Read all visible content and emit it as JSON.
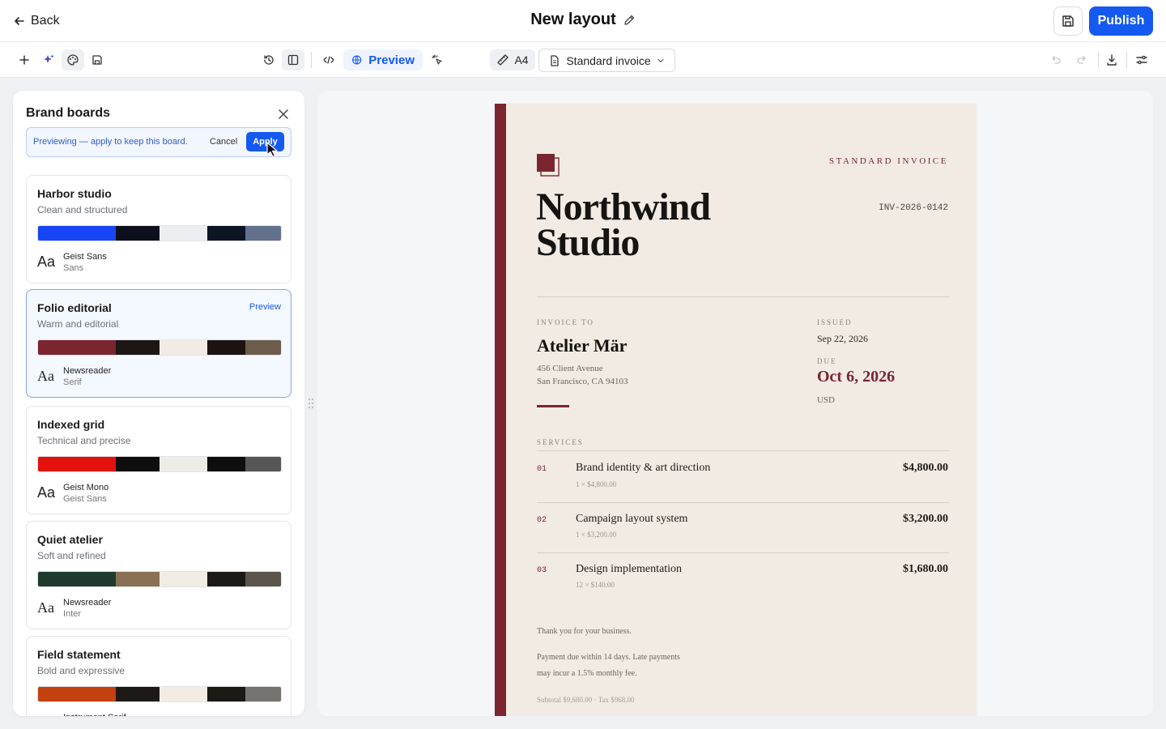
{
  "header": {
    "back_label": "Back",
    "title": "New layout",
    "publish_label": "Publish"
  },
  "toolbar": {
    "preview_label": "Preview",
    "paper_size": "A4",
    "template": "Standard invoice"
  },
  "panel": {
    "title": "Brand boards",
    "notice": {
      "text": "Previewing — apply to keep this board.",
      "cancel": "Cancel",
      "apply": "Apply"
    },
    "boards": [
      {
        "name": "Harbor studio",
        "desc": "Clean and structured",
        "colors": [
          "#1745f5",
          "#0c101c",
          "#eceef2",
          "#0d1424",
          "#62718c"
        ],
        "font": "Geist Sans",
        "font_sub": "Sans",
        "aa_serif": false
      },
      {
        "name": "Folio editorial",
        "desc": "Warm and editorial",
        "preview": "Preview",
        "colors": [
          "#7a2530",
          "#1c1714",
          "#f1ebe3",
          "#1c1310",
          "#6c5c4c"
        ],
        "font": "Newsreader",
        "font_sub": "Serif",
        "aa_serif": true
      },
      {
        "name": "Indexed grid",
        "desc": "Technical and precise",
        "colors": [
          "#e3120e",
          "#0e0e0e",
          "#eeece6",
          "#0e0e0e",
          "#565656"
        ],
        "font": "Geist Mono",
        "font_sub": "Geist Sans",
        "aa_serif": false
      },
      {
        "name": "Quiet atelier",
        "desc": "Soft and refined",
        "colors": [
          "#1f3a2c",
          "#8a7154",
          "#f1ece4",
          "#1c1916",
          "#5b554c"
        ],
        "font": "Newsreader",
        "font_sub": "Inter",
        "aa_serif": true
      },
      {
        "name": "Field statement",
        "desc": "Bold and expressive",
        "colors": [
          "#c3410f",
          "#1c1916",
          "#f2ece3",
          "#1c1814",
          "#757370"
        ],
        "font": "Instrument Serif",
        "font_sub": "",
        "aa_serif": true
      }
    ]
  },
  "invoice": {
    "label": "STANDARD INVOICE",
    "company_line1": "Northwind",
    "company_line2": "Studio",
    "number": "INV-2026-0142",
    "invoice_to_label": "INVOICE TO",
    "client": "Atelier Mär",
    "addr1": "456 Client Avenue",
    "addr2": "San Francisco, CA 94103",
    "issued_label": "ISSUED",
    "issued": "Sep 22, 2026",
    "due_label": "DUE",
    "due": "Oct 6, 2026",
    "currency": "USD",
    "services_label": "SERVICES",
    "items": [
      {
        "num": "01",
        "name": "Brand identity & art direction",
        "sub": "1 × $4,800.00",
        "amount": "$4,800.00"
      },
      {
        "num": "02",
        "name": "Campaign layout system",
        "sub": "1 × $3,200.00",
        "amount": "$3,200.00"
      },
      {
        "num": "03",
        "name": "Design implementation",
        "sub": "12 × $140.00",
        "amount": "$1,680.00"
      }
    ],
    "thanks": "Thank you for your business.",
    "terms1": "Payment due within 14 days. Late payments",
    "terms2": "may incur a 1.5% monthly fee.",
    "totals": "Subtotal $9,680.00 · Tax $968.00"
  }
}
